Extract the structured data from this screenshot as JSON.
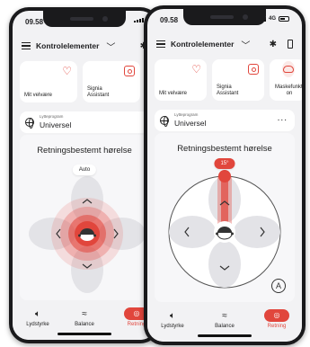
{
  "status": {
    "time": "09.58",
    "network": "4G"
  },
  "header": {
    "title": "Kontrolelementer"
  },
  "tiles": [
    {
      "label": "Mit velvære",
      "icon": "heart-icon"
    },
    {
      "label": "Signia Assistant",
      "icon": "assistant-icon"
    },
    {
      "label": "Maskefunktion",
      "icon": "mask-icon"
    }
  ],
  "program": {
    "caption": "Lytteprogram",
    "name": "Universel",
    "more": "..."
  },
  "directional": {
    "title": "Retningsbestemt hørelse",
    "back_phone_pill": "Auto",
    "front_phone_pill": "15°",
    "auto_button": "A"
  },
  "nav": {
    "volume": "Lydstyrke",
    "balance": "Balance",
    "direction": "Retning"
  },
  "colors": {
    "accent": "#e1463c",
    "background": "#f2f2f4"
  }
}
